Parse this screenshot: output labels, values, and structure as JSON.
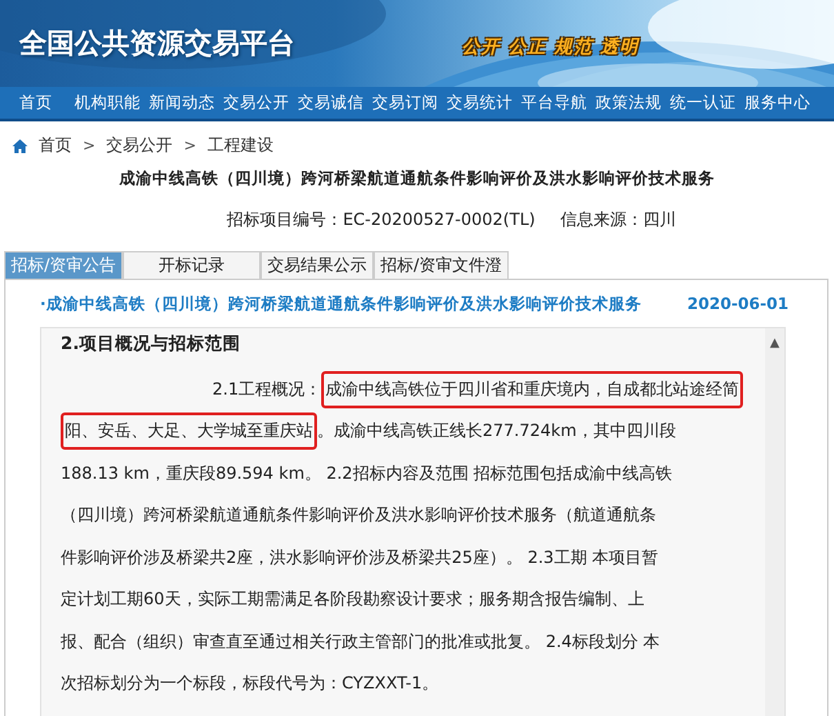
{
  "banner": {
    "site_title": "全国公共资源交易平台",
    "slogan": "公开 公正 规范 透明"
  },
  "nav": [
    {
      "label": "首页"
    },
    {
      "label": "机构职能"
    },
    {
      "label": "新闻动态"
    },
    {
      "label": "交易公开"
    },
    {
      "label": "交易诚信"
    },
    {
      "label": "交易订阅"
    },
    {
      "label": "交易统计"
    },
    {
      "label": "平台导航"
    },
    {
      "label": "政策法规"
    },
    {
      "label": "统一认证"
    },
    {
      "label": "服务中心"
    }
  ],
  "breadcrumb": [
    "首页",
    "交易公开",
    "工程建设"
  ],
  "breadcrumb_separator": ">",
  "project": {
    "title": "成渝中线高铁（四川境）跨河桥梁航道通航条件影响评价及洪水影响评价技术服务",
    "number_label": "招标项目编号：",
    "number": "EC-20200527-0002(TL)",
    "source_label": "信息来源：",
    "source": "四川"
  },
  "tabs": [
    {
      "label": "招标/资审公告",
      "selected": true
    },
    {
      "label": "开标记录",
      "selected": false
    },
    {
      "label": "交易结果公示",
      "selected": false
    },
    {
      "label": "招标/资审文件澄",
      "selected": false
    }
  ],
  "notice": {
    "bullet": "·",
    "title": "成渝中线高铁（四川境）跨河桥梁航道通航条件影响评价及洪水影响评价技术服务",
    "date": "2020-06-01"
  },
  "content": {
    "heading": "2.项目概况与招标范围",
    "lines": [
      [
        {
          "text": "2.1工程概况：",
          "highlighted": false
        },
        {
          "text": "成渝中线高铁位于四川省和重庆境内，自成都北站途经简",
          "highlighted": true
        }
      ],
      [
        {
          "text": "阳、安岳、大足、大学城至重庆站",
          "highlighted": true
        },
        {
          "text": "。成渝中线高铁正线长277.724km，其中四川段",
          "highlighted": false
        }
      ],
      [
        {
          "text": "188.13 km，重庆段89.594 km。 2.2招标内容及范围 招标范围包括成渝中线高铁",
          "highlighted": false
        }
      ],
      [
        {
          "text": "（四川境）跨河桥梁航道通航条件影响评价及洪水影响评价技术服务（航道通航条",
          "highlighted": false
        }
      ],
      [
        {
          "text": "件影响评价涉及桥梁共2座，洪水影响评价涉及桥梁共25座）。 2.3工期 本项目暂",
          "highlighted": false
        }
      ],
      [
        {
          "text": "定计划工期60天，实际工期需满足各阶段勘察设计要求；服务期含报告编制、上",
          "highlighted": false
        }
      ],
      [
        {
          "text": "报、配合（组织）审查直至通过相关行政主管部门的批准或批复。 2.4标段划分 本",
          "highlighted": false
        }
      ],
      [
        {
          "text": "次招标划分为一个标段，标段代号为：CYZXXT-1。",
          "highlighted": false
        }
      ]
    ],
    "scroll_up": "▲"
  }
}
